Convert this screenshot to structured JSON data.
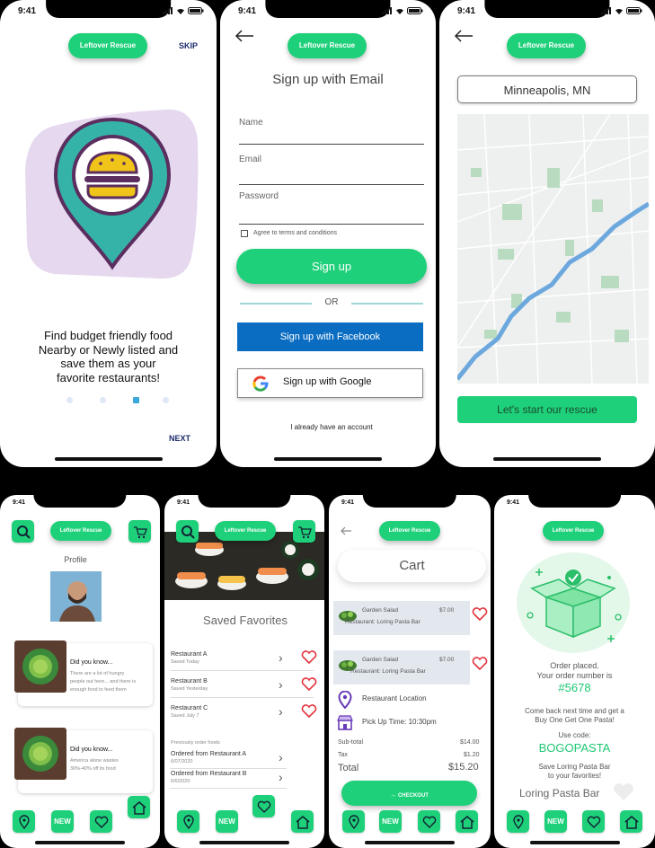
{
  "status": {
    "time": "9:41"
  },
  "brand": {
    "name": "Leftover Rescue"
  },
  "onboarding": {
    "skip": "SKIP",
    "headline": [
      "Find budget friendly food",
      "Nearby or Newly listed and",
      "save them as your",
      "favorite restaurants!"
    ],
    "next": "NEXT",
    "colors": {
      "blob": "#e5d8ef",
      "pin": "#36b3a8",
      "pin_outline": "#5c2d5f",
      "burger": "#f0c419"
    }
  },
  "signup": {
    "title": "Sign up with Email",
    "fields": [
      "Name",
      "Email",
      "Password"
    ],
    "terms": "Agree to terms and conditions",
    "signup_button": "Sign up",
    "or": "OR",
    "facebook": "Sign up with Facebook",
    "google": "Sign up with Google",
    "have_account": "I already have an account"
  },
  "location": {
    "city": "Minneapolis, MN",
    "cta": "Let's start our rescue"
  },
  "profile": {
    "title": "Profile",
    "cards": [
      {
        "title": "Did you know...",
        "lines": [
          "There are a lot of hungry",
          "people out here... and there is",
          "enough food to feed them"
        ]
      },
      {
        "title": "Did you know...",
        "lines": [
          "America alone wastes",
          "30%-40% off its food"
        ]
      }
    ]
  },
  "nav": {
    "new": "NEW"
  },
  "favorites": {
    "title": "Saved Favorites",
    "restaurants": [
      {
        "name": "Restaurant A",
        "sub": "Saved Today"
      },
      {
        "name": "Restaurant B",
        "sub": "Saved Yesterday"
      },
      {
        "name": "Restaurant C",
        "sub": "Saved July 7"
      }
    ],
    "prev_label": "Previously order foods",
    "previous": [
      {
        "name": "Ordered from Restaurant A",
        "date": "6/07/2020"
      },
      {
        "name": "Ordered from Restaurant B",
        "date": "6/6/2020"
      }
    ]
  },
  "cart": {
    "title": "Cart",
    "items": [
      {
        "name": "Garden Salad",
        "price": "$7.00",
        "restaurant": "Restaurant: Loring Pasta Bar"
      },
      {
        "name": "Garden Salad",
        "price": "$7.00",
        "restaurant": "Restaurant: Loring Pasta Bar"
      }
    ],
    "location_label": "Restaurant Location",
    "pickup_label": "Pick Up Time: 10:30pm",
    "subtotal_label": "Sub-total",
    "subtotal": "$14.00",
    "tax_label": "Tax",
    "tax": "$1.20",
    "total_label": "Total",
    "total": "$15.20",
    "checkout": "CHECKOUT"
  },
  "confirm": {
    "placed": "Order placed.",
    "number_label": "Your order number is",
    "number": "#5678",
    "promo_1": "Come back next time and get a",
    "promo_2": "Buy One Get One Pasta!",
    "use_code": "Use code:",
    "code": "BOGOPASTA",
    "save_1": "Save Loring Pasta Bar",
    "save_2": "to your favorites!",
    "restaurant": "Loring Pasta Bar"
  }
}
